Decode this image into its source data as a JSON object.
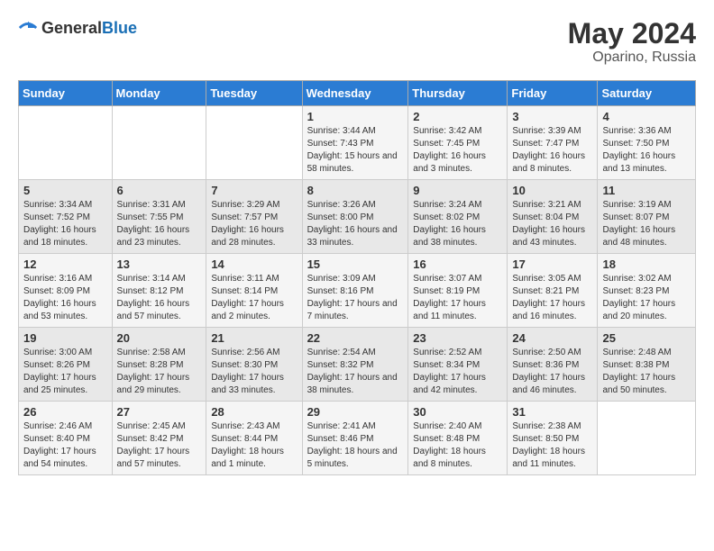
{
  "header": {
    "logo": {
      "general": "General",
      "blue": "Blue"
    },
    "title": "May 2024",
    "location": "Oparino, Russia"
  },
  "weekdays": [
    "Sunday",
    "Monday",
    "Tuesday",
    "Wednesday",
    "Thursday",
    "Friday",
    "Saturday"
  ],
  "weeks": [
    {
      "group": "a",
      "days": [
        {
          "num": "",
          "sunrise": "",
          "sunset": "",
          "daylight": ""
        },
        {
          "num": "",
          "sunrise": "",
          "sunset": "",
          "daylight": ""
        },
        {
          "num": "",
          "sunrise": "",
          "sunset": "",
          "daylight": ""
        },
        {
          "num": "1",
          "sunrise": "Sunrise: 3:44 AM",
          "sunset": "Sunset: 7:43 PM",
          "daylight": "Daylight: 15 hours and 58 minutes."
        },
        {
          "num": "2",
          "sunrise": "Sunrise: 3:42 AM",
          "sunset": "Sunset: 7:45 PM",
          "daylight": "Daylight: 16 hours and 3 minutes."
        },
        {
          "num": "3",
          "sunrise": "Sunrise: 3:39 AM",
          "sunset": "Sunset: 7:47 PM",
          "daylight": "Daylight: 16 hours and 8 minutes."
        },
        {
          "num": "4",
          "sunrise": "Sunrise: 3:36 AM",
          "sunset": "Sunset: 7:50 PM",
          "daylight": "Daylight: 16 hours and 13 minutes."
        }
      ]
    },
    {
      "group": "b",
      "days": [
        {
          "num": "5",
          "sunrise": "Sunrise: 3:34 AM",
          "sunset": "Sunset: 7:52 PM",
          "daylight": "Daylight: 16 hours and 18 minutes."
        },
        {
          "num": "6",
          "sunrise": "Sunrise: 3:31 AM",
          "sunset": "Sunset: 7:55 PM",
          "daylight": "Daylight: 16 hours and 23 minutes."
        },
        {
          "num": "7",
          "sunrise": "Sunrise: 3:29 AM",
          "sunset": "Sunset: 7:57 PM",
          "daylight": "Daylight: 16 hours and 28 minutes."
        },
        {
          "num": "8",
          "sunrise": "Sunrise: 3:26 AM",
          "sunset": "Sunset: 8:00 PM",
          "daylight": "Daylight: 16 hours and 33 minutes."
        },
        {
          "num": "9",
          "sunrise": "Sunrise: 3:24 AM",
          "sunset": "Sunset: 8:02 PM",
          "daylight": "Daylight: 16 hours and 38 minutes."
        },
        {
          "num": "10",
          "sunrise": "Sunrise: 3:21 AM",
          "sunset": "Sunset: 8:04 PM",
          "daylight": "Daylight: 16 hours and 43 minutes."
        },
        {
          "num": "11",
          "sunrise": "Sunrise: 3:19 AM",
          "sunset": "Sunset: 8:07 PM",
          "daylight": "Daylight: 16 hours and 48 minutes."
        }
      ]
    },
    {
      "group": "a",
      "days": [
        {
          "num": "12",
          "sunrise": "Sunrise: 3:16 AM",
          "sunset": "Sunset: 8:09 PM",
          "daylight": "Daylight: 16 hours and 53 minutes."
        },
        {
          "num": "13",
          "sunrise": "Sunrise: 3:14 AM",
          "sunset": "Sunset: 8:12 PM",
          "daylight": "Daylight: 16 hours and 57 minutes."
        },
        {
          "num": "14",
          "sunrise": "Sunrise: 3:11 AM",
          "sunset": "Sunset: 8:14 PM",
          "daylight": "Daylight: 17 hours and 2 minutes."
        },
        {
          "num": "15",
          "sunrise": "Sunrise: 3:09 AM",
          "sunset": "Sunset: 8:16 PM",
          "daylight": "Daylight: 17 hours and 7 minutes."
        },
        {
          "num": "16",
          "sunrise": "Sunrise: 3:07 AM",
          "sunset": "Sunset: 8:19 PM",
          "daylight": "Daylight: 17 hours and 11 minutes."
        },
        {
          "num": "17",
          "sunrise": "Sunrise: 3:05 AM",
          "sunset": "Sunset: 8:21 PM",
          "daylight": "Daylight: 17 hours and 16 minutes."
        },
        {
          "num": "18",
          "sunrise": "Sunrise: 3:02 AM",
          "sunset": "Sunset: 8:23 PM",
          "daylight": "Daylight: 17 hours and 20 minutes."
        }
      ]
    },
    {
      "group": "b",
      "days": [
        {
          "num": "19",
          "sunrise": "Sunrise: 3:00 AM",
          "sunset": "Sunset: 8:26 PM",
          "daylight": "Daylight: 17 hours and 25 minutes."
        },
        {
          "num": "20",
          "sunrise": "Sunrise: 2:58 AM",
          "sunset": "Sunset: 8:28 PM",
          "daylight": "Daylight: 17 hours and 29 minutes."
        },
        {
          "num": "21",
          "sunrise": "Sunrise: 2:56 AM",
          "sunset": "Sunset: 8:30 PM",
          "daylight": "Daylight: 17 hours and 33 minutes."
        },
        {
          "num": "22",
          "sunrise": "Sunrise: 2:54 AM",
          "sunset": "Sunset: 8:32 PM",
          "daylight": "Daylight: 17 hours and 38 minutes."
        },
        {
          "num": "23",
          "sunrise": "Sunrise: 2:52 AM",
          "sunset": "Sunset: 8:34 PM",
          "daylight": "Daylight: 17 hours and 42 minutes."
        },
        {
          "num": "24",
          "sunrise": "Sunrise: 2:50 AM",
          "sunset": "Sunset: 8:36 PM",
          "daylight": "Daylight: 17 hours and 46 minutes."
        },
        {
          "num": "25",
          "sunrise": "Sunrise: 2:48 AM",
          "sunset": "Sunset: 8:38 PM",
          "daylight": "Daylight: 17 hours and 50 minutes."
        }
      ]
    },
    {
      "group": "a",
      "days": [
        {
          "num": "26",
          "sunrise": "Sunrise: 2:46 AM",
          "sunset": "Sunset: 8:40 PM",
          "daylight": "Daylight: 17 hours and 54 minutes."
        },
        {
          "num": "27",
          "sunrise": "Sunrise: 2:45 AM",
          "sunset": "Sunset: 8:42 PM",
          "daylight": "Daylight: 17 hours and 57 minutes."
        },
        {
          "num": "28",
          "sunrise": "Sunrise: 2:43 AM",
          "sunset": "Sunset: 8:44 PM",
          "daylight": "Daylight: 18 hours and 1 minute."
        },
        {
          "num": "29",
          "sunrise": "Sunrise: 2:41 AM",
          "sunset": "Sunset: 8:46 PM",
          "daylight": "Daylight: 18 hours and 5 minutes."
        },
        {
          "num": "30",
          "sunrise": "Sunrise: 2:40 AM",
          "sunset": "Sunset: 8:48 PM",
          "daylight": "Daylight: 18 hours and 8 minutes."
        },
        {
          "num": "31",
          "sunrise": "Sunrise: 2:38 AM",
          "sunset": "Sunset: 8:50 PM",
          "daylight": "Daylight: 18 hours and 11 minutes."
        },
        {
          "num": "",
          "sunrise": "",
          "sunset": "",
          "daylight": ""
        }
      ]
    }
  ]
}
